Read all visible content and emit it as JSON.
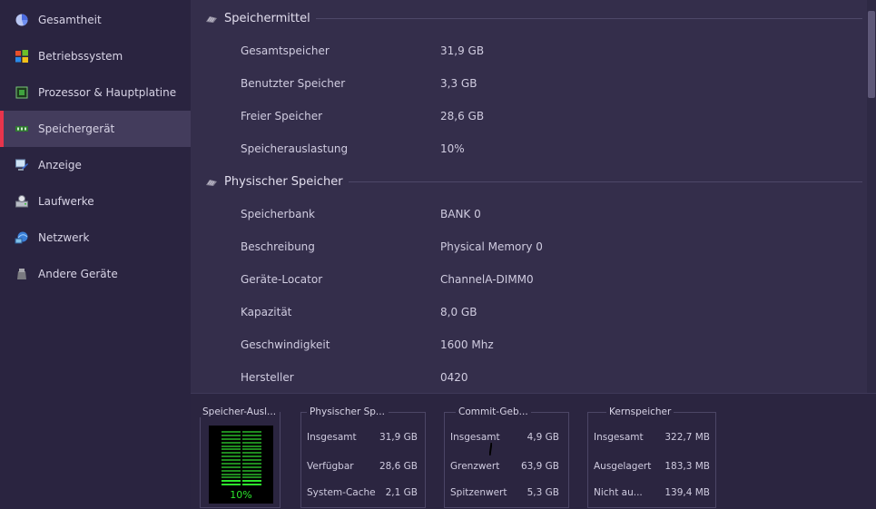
{
  "sidebar": {
    "items": [
      {
        "label": "Gesamtheit",
        "icon": "pie-chart-icon"
      },
      {
        "label": "Betriebssystem",
        "icon": "windows-logo-icon"
      },
      {
        "label": "Prozessor & Hauptplatine",
        "icon": "chip-icon"
      },
      {
        "label": "Speichergerät",
        "icon": "memory-module-icon",
        "active": true
      },
      {
        "label": "Anzeige",
        "icon": "monitor-icon"
      },
      {
        "label": "Laufwerke",
        "icon": "drive-icon"
      },
      {
        "label": "Netzwerk",
        "icon": "network-icon"
      },
      {
        "label": "Andere Geräte",
        "icon": "device-icon"
      }
    ]
  },
  "sections": {
    "speichermittel": {
      "title": "Speichermittel",
      "rows": [
        {
          "key": "Gesamtspeicher",
          "value": "31,9 GB"
        },
        {
          "key": "Benutzter Speicher",
          "value": "3,3 GB"
        },
        {
          "key": "Freier Speicher",
          "value": "28,6 GB"
        },
        {
          "key": "Speicherauslastung",
          "value": "10%"
        }
      ]
    },
    "physisch": {
      "title": "Physischer Speicher",
      "rows": [
        {
          "key": "Speicherbank",
          "value": "BANK 0"
        },
        {
          "key": "Beschreibung",
          "value": "Physical Memory 0"
        },
        {
          "key": "Geräte-Locator",
          "value": "ChannelA-DIMM0"
        },
        {
          "key": "Kapazität",
          "value": "8,0 GB"
        },
        {
          "key": "Geschwindigkeit",
          "value": "1600 Mhz"
        },
        {
          "key": "Hersteller",
          "value": "0420"
        }
      ]
    }
  },
  "bottom": {
    "usage": {
      "title": "Speicher-Ausl...",
      "percent_label": "10%",
      "level": 0.1
    },
    "physisch": {
      "title": "Physischer Sp...",
      "rows": [
        {
          "key": "Insgesamt",
          "value": "31,9 GB"
        },
        {
          "key": "Verfügbar",
          "value": "28,6 GB"
        },
        {
          "key": "System-Cache",
          "value": "2,1 GB"
        }
      ]
    },
    "commit": {
      "title": "Commit-Geb...",
      "rows": [
        {
          "key": "Insgesamt",
          "value": "4,9 GB"
        },
        {
          "key": "Grenzwert",
          "value": "63,9 GB"
        },
        {
          "key": "Spitzenwert",
          "value": "5,3 GB"
        }
      ]
    },
    "kern": {
      "title": "Kernspeicher",
      "rows": [
        {
          "key": "Insgesamt",
          "value": "322,7 MB"
        },
        {
          "key": "Ausgelagert",
          "value": "183,3 MB"
        },
        {
          "key": "Nicht au...",
          "value": "139,4 MB"
        }
      ]
    }
  },
  "colors": {
    "accent": "#e8344c",
    "meter_on": "#2de62d",
    "meter_off": "#1f8a1f"
  }
}
